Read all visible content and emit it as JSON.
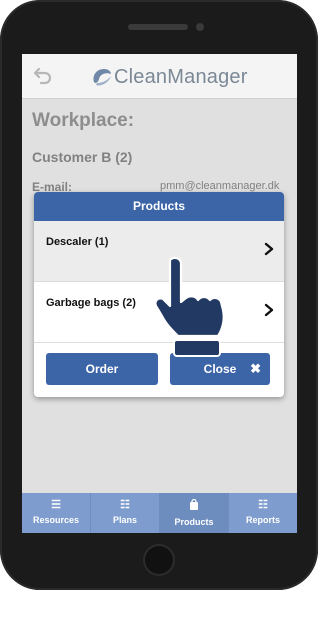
{
  "app": {
    "logo_text": "CleanManager",
    "back_icon": "back-arrow-icon"
  },
  "page": {
    "workplace_title": "Workplace:",
    "customer_name": "Customer B (2)",
    "email_label": "E-mail:",
    "email_value": "pmm@cleanmanager.dk"
  },
  "dialog": {
    "title": "Products",
    "items": [
      {
        "label": "Descaler (1)",
        "selected": true
      },
      {
        "label": "Garbage bags (2)",
        "selected": false
      }
    ],
    "order_label": "Order",
    "close_label": "Close"
  },
  "tabbar": {
    "tabs": [
      {
        "label": "Resources",
        "icon": "list-icon",
        "active": false
      },
      {
        "label": "Plans",
        "icon": "checklist-icon",
        "active": false
      },
      {
        "label": "Products",
        "icon": "bag-icon",
        "active": true
      },
      {
        "label": "Reports",
        "icon": "checklist-icon",
        "active": false
      }
    ]
  },
  "colors": {
    "primary": "#3c65a8",
    "tabbar": "#7e9ccd"
  }
}
